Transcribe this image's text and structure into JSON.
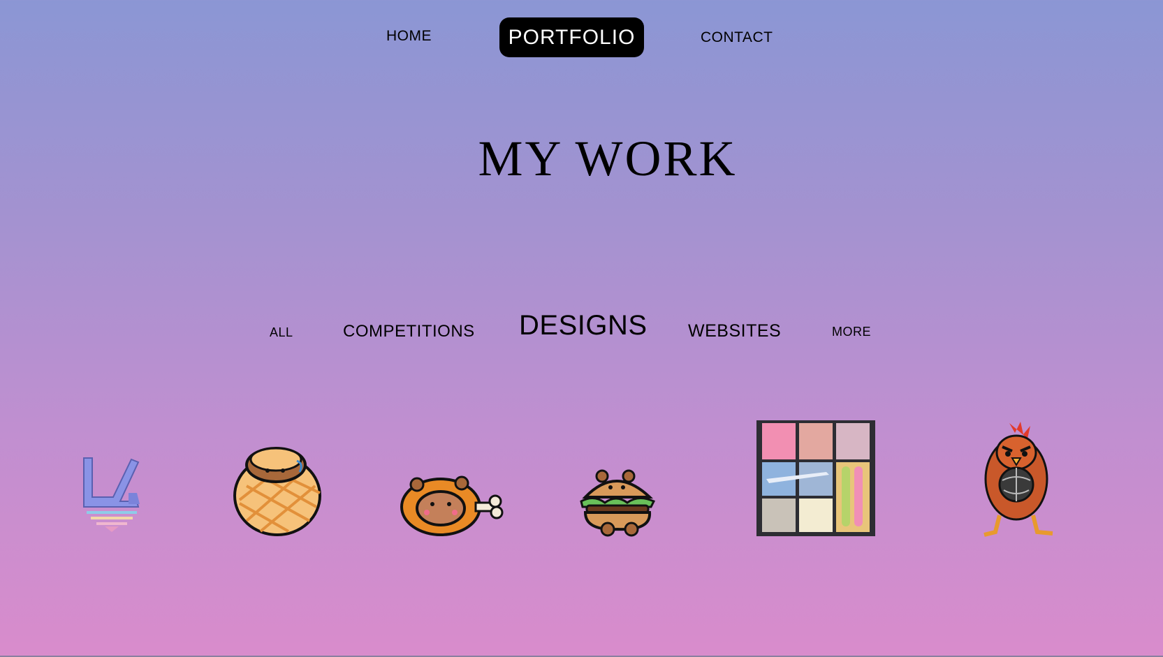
{
  "nav": {
    "home": "HOME",
    "portfolio": "PORTFOLIO",
    "contact": "CONTACT"
  },
  "page": {
    "title": "MY WORK"
  },
  "categories": {
    "all": "ALL",
    "competitions": "COMPETITIONS",
    "designs": "DESIGNS",
    "websites": "WEBSITES",
    "more": "MORE"
  },
  "gallery": {
    "items": [
      {
        "icon": "letter-logo-icon"
      },
      {
        "icon": "melon-bun-capybara-icon"
      },
      {
        "icon": "fried-drumstick-capybara-icon"
      },
      {
        "icon": "burger-capybara-icon"
      },
      {
        "icon": "travel-collage-grid-icon"
      },
      {
        "icon": "angry-chicken-mascot-icon"
      }
    ]
  },
  "colors": {
    "gradient_top": "#8b96d4",
    "gradient_bottom": "#d98ccc",
    "active_nav_bg": "#000000"
  }
}
